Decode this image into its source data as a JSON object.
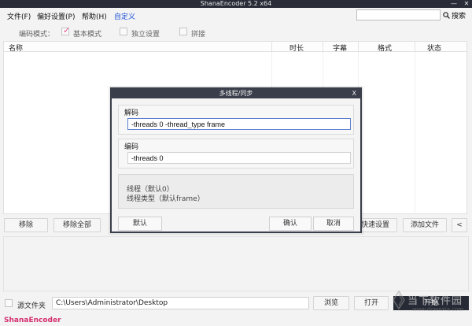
{
  "window": {
    "title": "ShanaEncoder 5.2 x64",
    "minimize": "—",
    "close": "✕"
  },
  "menu": {
    "file": "文件(F)",
    "prefs": "偏好设置(P)",
    "help": "帮助(H)",
    "custom": "自定义",
    "search_label": "搜索",
    "search_value": ""
  },
  "mode": {
    "label": "编码模式：",
    "basic": "基本模式",
    "basic_checked": true,
    "independent": "独立设置",
    "independent_checked": false,
    "concat": "拼接",
    "concat_checked": false
  },
  "table": {
    "columns": [
      "名称",
      "时长",
      "字幕",
      "格式",
      "状态"
    ],
    "rows": []
  },
  "buttons": {
    "remove": "移除",
    "remove_all": "移除全部",
    "quick_settings": "快速设置",
    "add_file": "添加文件",
    "collapse": "<",
    "browse": "浏览",
    "open": "打开",
    "start": "开始"
  },
  "source": {
    "label": "源文件夹",
    "checked": false,
    "path": "C:\\Users\\Administrator\\Desktop"
  },
  "brand": "ShanaEncoder",
  "watermark": {
    "text": "当下软件园",
    "url": "www.downxia.com"
  },
  "dialog": {
    "title": "多线程/同步",
    "close": "X",
    "decode_label": "解码",
    "decode_value": "-threads 0 -thread_type frame",
    "encode_label": "编码",
    "encode_value": "-threads 0",
    "info_line1": "线程（默认0）",
    "info_line2": "线程类型（默认frame）",
    "default_btn": "默认",
    "ok_btn": "确认",
    "cancel_btn": "取消"
  },
  "colors": {
    "titlebar": "#2a2d38",
    "dialog_border": "#3a3e4a",
    "accent_pink": "#d42f6e",
    "custom_menu_blue": "#1a4fd6",
    "start_bg": "#262a34"
  }
}
